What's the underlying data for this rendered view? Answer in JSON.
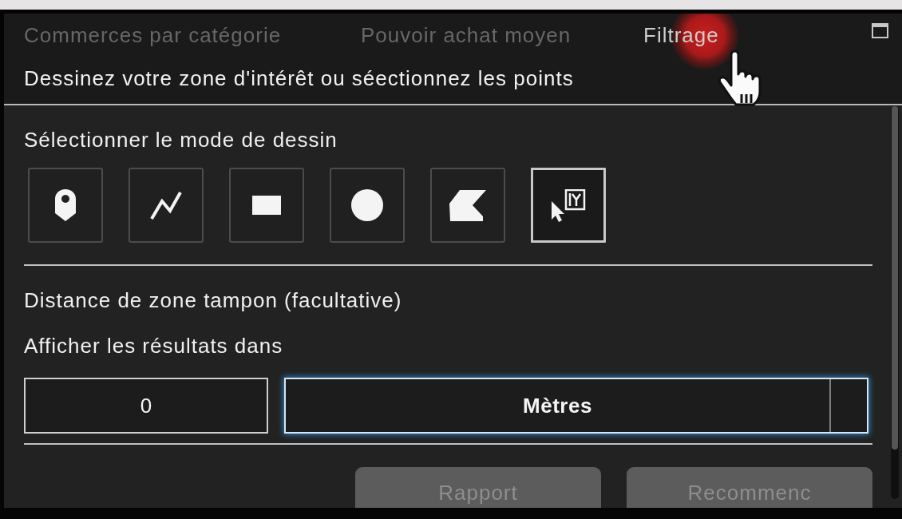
{
  "tabs": [
    {
      "label": "Commerces par catégorie",
      "selected": false
    },
    {
      "label": "Pouvoir achat moyen",
      "selected": false
    },
    {
      "label": "Filtrage",
      "selected": true
    }
  ],
  "instruction": "Dessinez votre zone d'intérêt ou séectionnez les points",
  "draw_mode": {
    "label": "Sélectionner le mode de dessin",
    "modes": [
      {
        "kind": "point",
        "selected": false
      },
      {
        "kind": "polyline",
        "selected": false
      },
      {
        "kind": "rectangle",
        "selected": false
      },
      {
        "kind": "circle",
        "selected": false
      },
      {
        "kind": "polygon",
        "selected": false
      },
      {
        "kind": "select",
        "selected": true
      }
    ]
  },
  "buffer": {
    "label": "Distance de zone tampon (facultative)",
    "units_label": "Afficher les résultats dans",
    "distance": {
      "value": "0"
    },
    "unit_select": {
      "value": "Mètres",
      "focused": true
    }
  },
  "buttons": [
    {
      "label": "Rapport",
      "disabled": true
    },
    {
      "label": "Recommenc",
      "disabled": true
    }
  ],
  "pointer": {
    "kind": "hand",
    "clicking": true
  }
}
